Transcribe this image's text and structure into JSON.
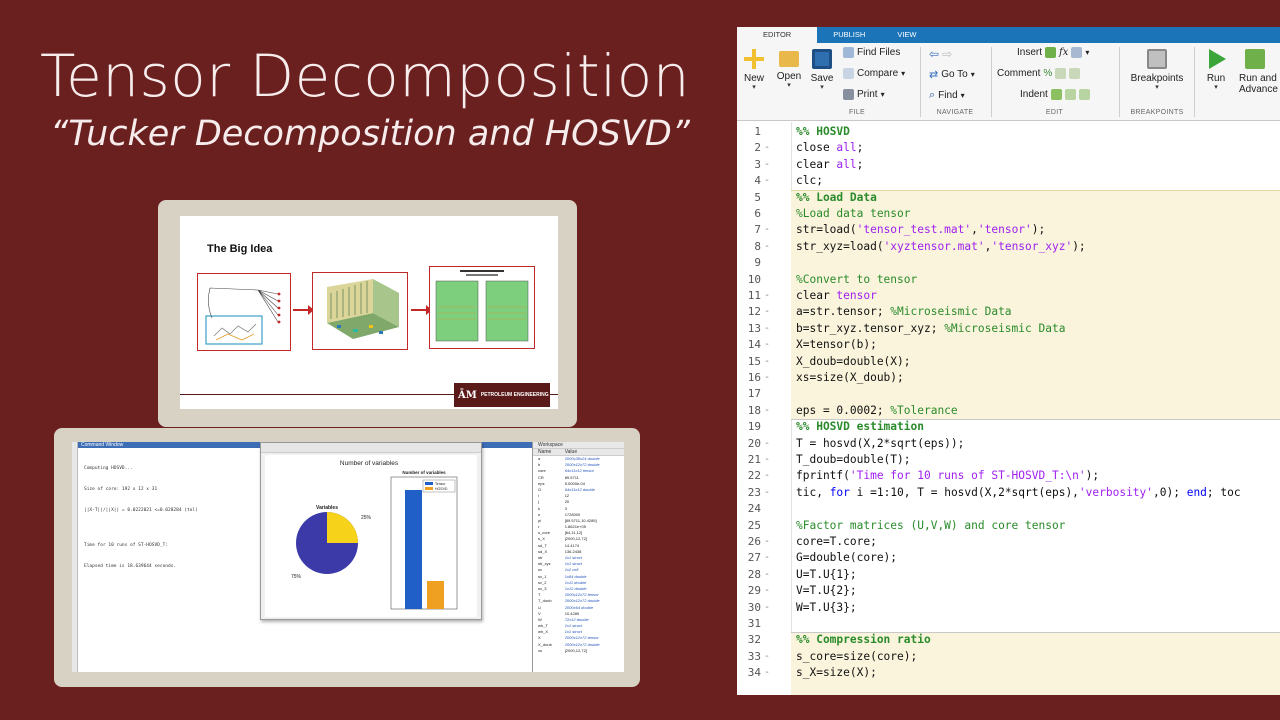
{
  "title": "Tensor Decomposition",
  "subtitle": "“Tucker Decomposition and HOSVD”",
  "slide": {
    "title": "The Big Idea",
    "logo_mark": "ĀM",
    "logo_text": "PETROLEUM ENGINEERING"
  },
  "matlab_window": {
    "command_window_title": "Command Window",
    "command_lines": [
      "Computing HOSVD...",
      "Size of core: 192 x 12 x 31",
      "||X-T||/||X|| = 0.0222021 <=0.028284 (tol)",
      "",
      "Time for 10 runs of ST-HOSVD_T:",
      "Elapsed time is 18.639644 seconds."
    ],
    "figure": {
      "title": "Number of variables",
      "pie_title": "Variables",
      "pie_label_small": "25%",
      "pie_label_large": "75%",
      "bar_title": "Number of variables",
      "legend": [
        "Tensor",
        "HOSVD"
      ]
    },
    "workspace": {
      "title": "Workspace",
      "col_name": "Name",
      "col_value": "Value",
      "rows": [
        [
          "a",
          "2000x38x24 double"
        ],
        [
          "b",
          "2000x12x72 double"
        ],
        [
          "core",
          "64x11x12 tensor"
        ],
        [
          "CR",
          "89.5711"
        ],
        [
          "eps",
          "5.0000e-04"
        ],
        [
          "G",
          "64x11x12 double"
        ],
        [
          "i",
          "12"
        ],
        [
          "j",
          "20"
        ],
        [
          "k",
          "3"
        ],
        [
          "n",
          "1728000"
        ],
        [
          "pi",
          "[89.5711,10.4289]"
        ],
        [
          "r",
          "1.8621e+05"
        ],
        [
          "s_core",
          "[64,11,12]"
        ],
        [
          "s_X",
          "[2000,12,72]"
        ],
        [
          "sd_T",
          "14.4174"
        ],
        [
          "sd_X",
          "136.2438"
        ],
        [
          "str",
          "1x1 struct"
        ],
        [
          "str_xyz",
          "1x1 struct"
        ],
        [
          "sv",
          "1x2 cell"
        ],
        [
          "sv_1",
          "1x84 double"
        ],
        [
          "sv_2",
          "1x11 double"
        ],
        [
          "sv_3",
          "1x12 double"
        ],
        [
          "T",
          "2000x12x72 tensor"
        ],
        [
          "T_doub",
          "2000x12x72 double"
        ],
        [
          "U",
          "2000x64 double"
        ],
        [
          "V",
          "10.4289"
        ],
        [
          "W",
          "72x12 double"
        ],
        [
          "wh_T",
          "1x1 struct"
        ],
        [
          "wh_X",
          "1x1 struct"
        ],
        [
          "X",
          "2000x12x72 tensor"
        ],
        [
          "X_doub",
          "2000x12x72 double"
        ],
        [
          "xs",
          "[2000,12,72]"
        ]
      ]
    }
  },
  "editor": {
    "tabs": [
      "EDITOR",
      "PUBLISH",
      "VIEW"
    ],
    "ribbon": {
      "new": "New",
      "open": "Open",
      "save": "Save",
      "find_files": "Find Files",
      "compare": "Compare",
      "print": "Print",
      "file_section": "FILE",
      "go_to": "Go To",
      "find": "Find",
      "navigate_section": "NAVIGATE",
      "insert": "Insert",
      "comment": "Comment",
      "indent": "Indent",
      "edit_section": "EDIT",
      "breakpoints": "Breakpoints",
      "breakpoints_section": "BREAKPOINTS",
      "run": "Run",
      "run_advance_1": "Run and",
      "run_advance_2": "Advance"
    },
    "lines": [
      {
        "n": "1",
        "t": "%% HOSVD"
      },
      {
        "n": "2",
        "t": "close all;"
      },
      {
        "n": "3",
        "t": "clear all;"
      },
      {
        "n": "4",
        "t": "clc;"
      },
      {
        "n": "5",
        "t": "%% Load Data"
      },
      {
        "n": "6",
        "t": "%Load data tensor"
      },
      {
        "n": "7",
        "t": "str=load('tensor_test.mat','tensor');"
      },
      {
        "n": "8",
        "t": "str_xyz=load('xyztensor.mat','tensor_xyz');"
      },
      {
        "n": "9",
        "t": ""
      },
      {
        "n": "10",
        "t": "%Convert to tensor"
      },
      {
        "n": "11",
        "t": "clear tensor"
      },
      {
        "n": "12",
        "t": "a=str.tensor; %Microseismic Data"
      },
      {
        "n": "13",
        "t": "b=str_xyz.tensor_xyz; %Microseismic Data"
      },
      {
        "n": "14",
        "t": "X=tensor(b);"
      },
      {
        "n": "15",
        "t": "X_doub=double(X);"
      },
      {
        "n": "16",
        "t": "xs=size(X_doub);"
      },
      {
        "n": "17",
        "t": ""
      },
      {
        "n": "18",
        "t": "eps = 0.0002; %Tolerance"
      },
      {
        "n": "19",
        "t": "%% HOSVD estimation"
      },
      {
        "n": "20",
        "t": "T = hosvd(X,2*sqrt(eps));"
      },
      {
        "n": "21",
        "t": "T_doub=double(T);"
      },
      {
        "n": "22",
        "t": "fprintf('Time for 10 runs of ST-HOSVD_T:\\n');"
      },
      {
        "n": "23",
        "t": "tic, for i =1:10, T = hosvd(X,2*sqrt(eps),'verbosity',0); end; toc"
      },
      {
        "n": "24",
        "t": ""
      },
      {
        "n": "25",
        "t": "%Factor matrices (U,V,W) and core tensor"
      },
      {
        "n": "26",
        "t": "core=T.core;"
      },
      {
        "n": "27",
        "t": "G=double(core);"
      },
      {
        "n": "28",
        "t": "U=T.U{1};"
      },
      {
        "n": "29",
        "t": "V=T.U{2};"
      },
      {
        "n": "30",
        "t": "W=T.U{3};"
      },
      {
        "n": "31",
        "t": ""
      },
      {
        "n": "32",
        "t": "%% Compression ratio"
      },
      {
        "n": "33",
        "t": "s_core=size(core);"
      },
      {
        "n": "34",
        "t": "s_X=size(X);"
      }
    ]
  },
  "colors": {
    "background": "#6b2020",
    "matlab_blue": "#1b74b8",
    "cell_highlight": "#faf4dc",
    "comment_green": "#2a8b2a",
    "string_purple": "#a020f0",
    "keyword_blue": "#0000ff",
    "chart_blue": "#1f5fc7",
    "chart_yellow": "#f0c419",
    "chart_orange": "#f0a020",
    "slide_red": "#c32828"
  }
}
